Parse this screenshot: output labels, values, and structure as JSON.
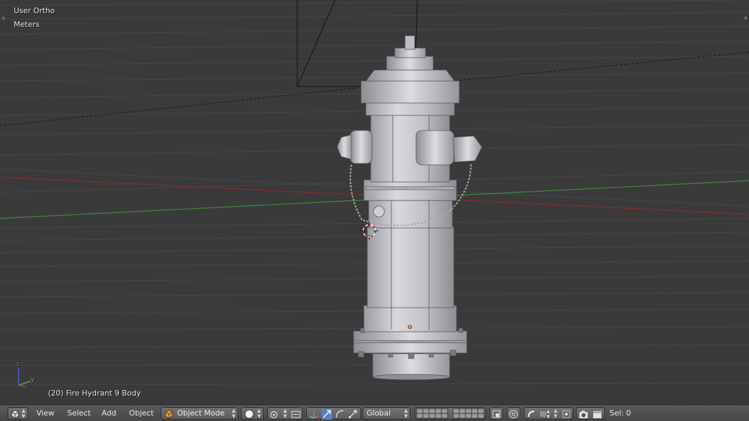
{
  "viewport": {
    "view_name": "User Ortho",
    "units": "Meters",
    "object_info": "(20) Fire Hydrant 9 Body",
    "axis_labels": {
      "z": "z",
      "y": "y"
    },
    "background_color": "#393939"
  },
  "header": {
    "menus": [
      "View",
      "Select",
      "Add",
      "Object"
    ],
    "mode_label": "Object Mode",
    "orientation_label": "Global",
    "selection_count": "Sel: 0"
  },
  "icons": {
    "editor_type": "3d-view-cube-icon",
    "mode": "object-mode-cube-icon",
    "shading": "solid-sphere-icon",
    "pivot": "pivot-point-icon",
    "manipulator": "manipulator-axes-icon",
    "translate": "translate-arrow-icon",
    "rotate": "rotate-arc-icon",
    "scale": "scale-arrow-icon",
    "layers": "layer-grid-icon",
    "lock_camera": "lock-layer-icon",
    "proportional": "proportional-edit-icon",
    "snap": "snap-magnet-icon",
    "snap_type": "snap-element-icon",
    "render_opengl": "render-camera-icon",
    "render_anim": "render-clapper-icon"
  }
}
